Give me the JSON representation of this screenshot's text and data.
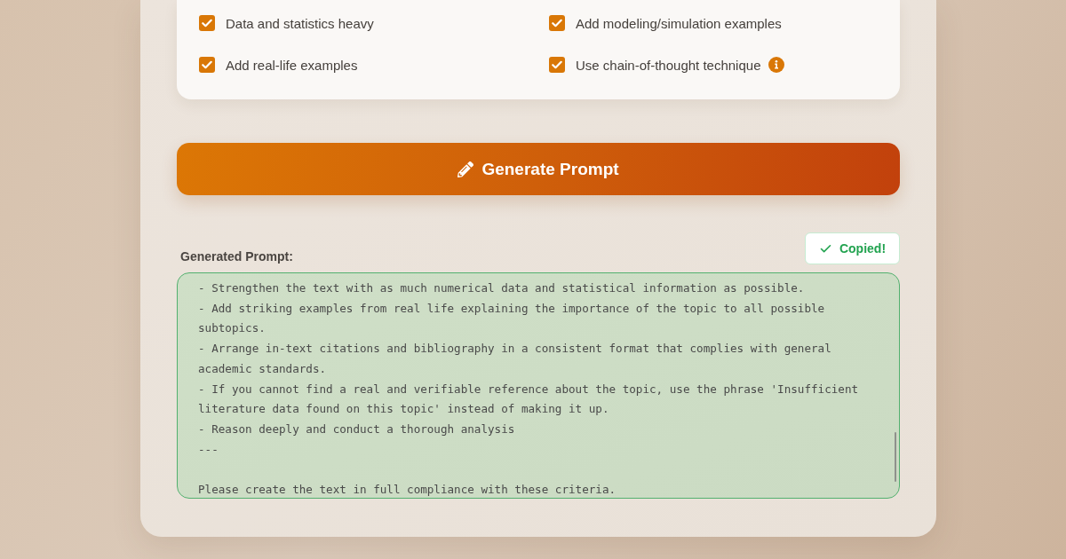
{
  "options": [
    {
      "label": "Data and statistics heavy",
      "checked": true
    },
    {
      "label": "Add modeling/simulation examples",
      "checked": true
    },
    {
      "label": "Add real-life examples",
      "checked": true
    },
    {
      "label": "Use chain-of-thought technique",
      "checked": true,
      "info": true
    }
  ],
  "generate_button": {
    "label": "Generate Prompt"
  },
  "output": {
    "label": "Generated Prompt:",
    "copy_button": {
      "label": "Copied!",
      "copied": true
    },
    "value": "- Strengthen the text with as much numerical data and statistical information as possible.\n- Add striking examples from real life explaining the importance of the topic to all possible subtopics.\n- Arrange in-text citations and bibliography in a consistent format that complies with general academic standards.\n- If you cannot find a real and verifiable reference about the topic, use the phrase 'Insufficient literature data found on this topic' instead of making it up.\n- Reason deeply and conduct a thorough analysis\n---\n\nPlease create the text in full compliance with these criteria."
  }
}
